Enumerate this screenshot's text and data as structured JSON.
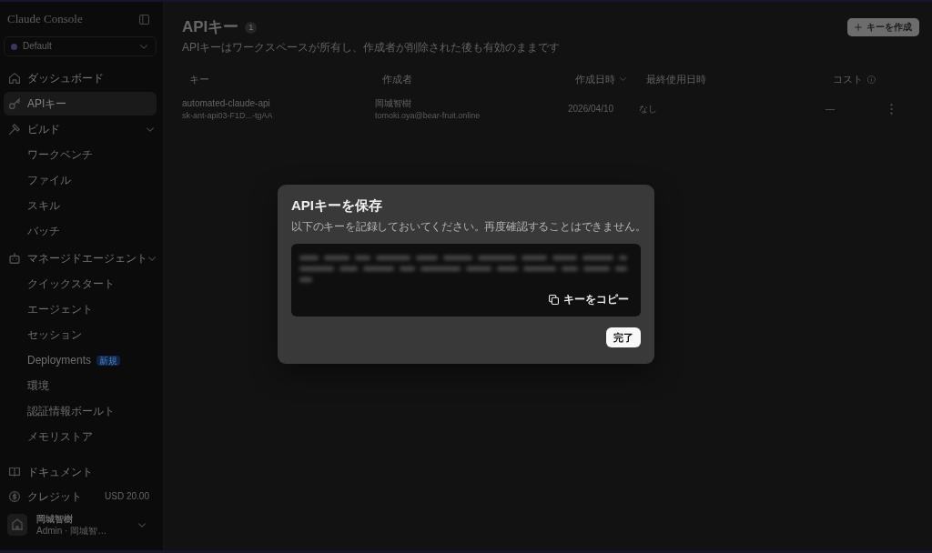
{
  "sidebar": {
    "title": "Claude Console",
    "workspace": {
      "name": "Default",
      "color": "#3b3566"
    },
    "nav": [
      {
        "label": "ダッシュボード",
        "selected": false
      },
      {
        "label": "APIキー",
        "selected": true
      },
      {
        "label": "ビルド",
        "selected": false,
        "expanded": true,
        "children": [
          {
            "label": "ワークベンチ",
            "selected": false
          },
          {
            "label": "ファイル",
            "selected": false
          },
          {
            "label": "スキル",
            "selected": false
          },
          {
            "label": "バッチ",
            "selected": false
          }
        ]
      },
      {
        "label": "マネージドエージェント",
        "selected": false,
        "expanded": true,
        "children": [
          {
            "label": "クイックスタート",
            "selected": false
          },
          {
            "label": "エージェント",
            "selected": false
          },
          {
            "label": "セッション",
            "selected": false
          },
          {
            "label": "Deployments",
            "badge": "新規",
            "selected": false
          },
          {
            "label": "環境",
            "selected": false
          },
          {
            "label": "認証情報ボールト",
            "selected": false
          },
          {
            "label": "メモリストア",
            "selected": false
          }
        ]
      }
    ],
    "footer": [
      {
        "label": "ドキュメント"
      },
      {
        "label": "クレジット",
        "value": "USD 20.00"
      }
    ],
    "user": {
      "name": "岡城智樹",
      "detail": "Admin · 岡城智…"
    }
  },
  "page": {
    "title": "APIキー",
    "count": "1",
    "subtitle": "APIキーはワークスペースが所有し、作成者が削除された後も有効のままです",
    "create_button": "キーを作成"
  },
  "table": {
    "columns": [
      {
        "label": "キー",
        "sorted": false
      },
      {
        "label": "作成者",
        "sorted": false
      },
      {
        "label": "作成日時",
        "sorted": true
      },
      {
        "label": "最終使用日時",
        "sorted": false
      },
      {
        "label": "コスト",
        "sorted": false
      }
    ],
    "rows": [
      {
        "name": "automated-claude-api",
        "key": "sk-ant-api03-F1D...-tgAA",
        "creator": "岡城智樹",
        "email": "tomoki.oya@bear-fruit.online",
        "created": "2026/04/10",
        "last_used": "なし",
        "cost": "—"
      }
    ]
  },
  "dialog": {
    "title": "APIキーを保存",
    "message": "以下のキーを記録しておいてください。再度確認することはできません。",
    "copy_button": "キーをコピー",
    "done_button": "完了"
  }
}
